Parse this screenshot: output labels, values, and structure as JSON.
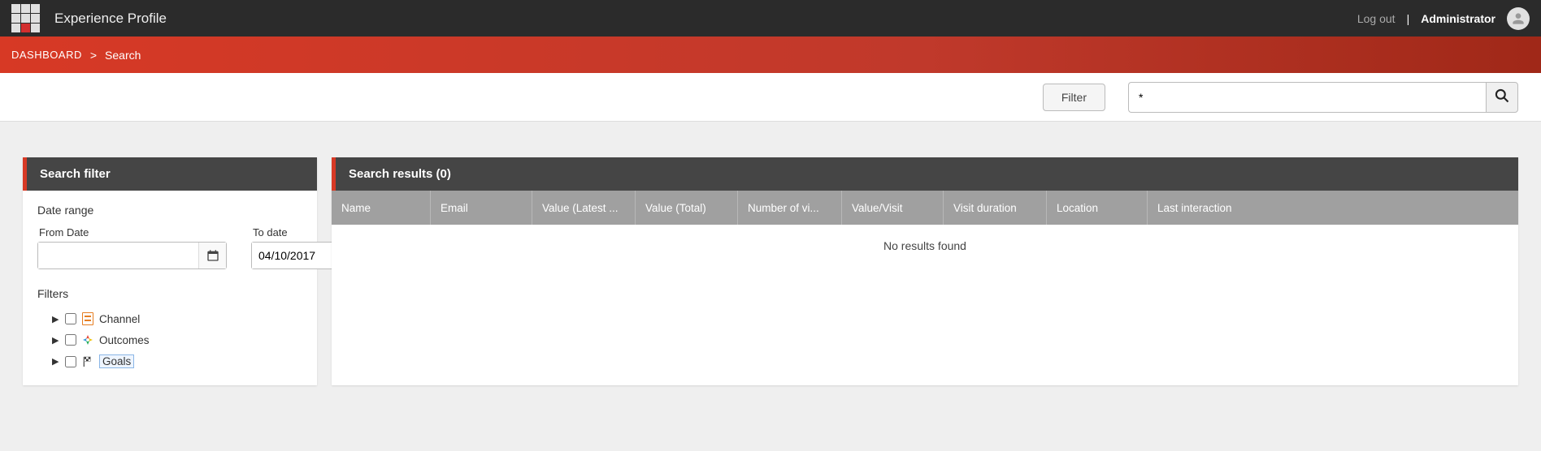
{
  "app": {
    "title": "Experience Profile"
  },
  "header": {
    "logout": "Log out",
    "divider": "|",
    "username": "Administrator"
  },
  "breadcrumb": {
    "dashboard": "DASHBOARD",
    "sep": ">",
    "current": "Search"
  },
  "actionbar": {
    "filter_button": "Filter",
    "search_value": "*"
  },
  "filter_panel": {
    "title": "Search filter",
    "date_range_label": "Date range",
    "from_label": "From Date",
    "from_value": "",
    "to_label": "To date",
    "to_value": "04/10/2017",
    "filters_label": "Filters",
    "tree": {
      "channel": "Channel",
      "outcomes": "Outcomes",
      "goals": "Goals"
    }
  },
  "results": {
    "title": "Search results (0)",
    "columns": {
      "name": "Name",
      "email": "Email",
      "value_latest": "Value (Latest ...",
      "value_total": "Value (Total)",
      "num_visits": "Number of vi...",
      "value_visit": "Value/Visit",
      "visit_duration": "Visit duration",
      "location": "Location",
      "last_interaction": "Last interaction"
    },
    "no_results": "No results found"
  }
}
